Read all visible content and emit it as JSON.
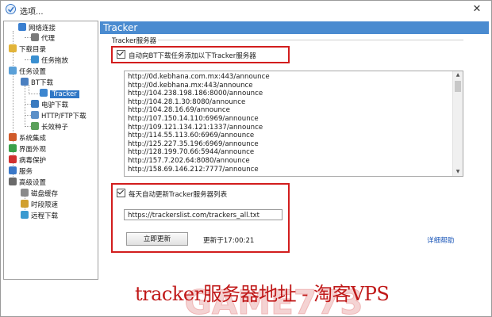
{
  "window": {
    "title": "选项..."
  },
  "tree": [
    {
      "label": "网络连接",
      "icon": "network-icon",
      "color": "#3a7fd0"
    },
    {
      "label": "代理",
      "icon": "proxy-icon",
      "color": "#7a7a7a"
    },
    {
      "label": "下载目录",
      "icon": "folder-icon",
      "color": "#e2b43a"
    },
    {
      "label": "任务拖放",
      "icon": "drag-icon",
      "color": "#3a8fd0"
    },
    {
      "label": "任务设置",
      "icon": "task-settings-icon",
      "color": "#5aa0d8"
    },
    {
      "label": "BT下载",
      "icon": "bt-icon",
      "color": "#4a7fc0"
    },
    {
      "label": "Tracker",
      "icon": "tracker-icon",
      "color": "#3d86cf"
    },
    {
      "label": "电驴下载",
      "icon": "emule-icon",
      "color": "#3a7bc0"
    },
    {
      "label": "HTTP/FTP下载",
      "icon": "http-ftp-icon",
      "color": "#5b90c8"
    },
    {
      "label": "长效种子",
      "icon": "seed-icon",
      "color": "#5aa05a"
    },
    {
      "label": "系统集成",
      "icon": "system-integration-icon",
      "color": "#d05a2a"
    },
    {
      "label": "界面外观",
      "icon": "appearance-icon",
      "color": "#3aa04a"
    },
    {
      "label": "病毒保护",
      "icon": "virus-protection-icon",
      "color": "#d03030"
    },
    {
      "label": "服务",
      "icon": "service-icon",
      "color": "#3a78c8"
    },
    {
      "label": "高级设置",
      "icon": "advanced-settings-icon",
      "color": "#6a6a6a"
    },
    {
      "label": "磁盘缓存",
      "icon": "disk-cache-icon",
      "color": "#8a8a8a"
    },
    {
      "label": "时段限速",
      "icon": "speed-limit-icon",
      "color": "#d0a030"
    },
    {
      "label": "远程下载",
      "icon": "remote-download-icon",
      "color": "#3a9ad0"
    }
  ],
  "panel": {
    "title": "Tracker",
    "group_label": "Tracker服务器",
    "auto_add_label": "自动向BT下载任务添加以下Tracker服务器",
    "auto_add_checked": true,
    "trackers": [
      "http://0d.kebhana.com.mx:443/announce",
      "http://0d.kebhana.mx:443/announce",
      "http://104.238.198.186:8000/announce",
      "http://104.28.1.30:8080/announce",
      "http://104.28.16.69/announce",
      "http://107.150.14.110:6969/announce",
      "http://109.121.134.121:1337/announce",
      "http://114.55.113.60:6969/announce",
      "http://125.227.35.196:6969/announce",
      "http://128.199.70.66:5944/announce",
      "http://157.7.202.64:8080/announce",
      "http://158.69.146.212:7777/announce"
    ],
    "daily_update_label": "每天自动更新Tracker服务器列表",
    "daily_update_checked": true,
    "update_url": "https://trackerslist.com/trackers_all.txt",
    "update_now_label": "立即更新",
    "updated_at": "更新于17:00:21",
    "help_link": "详细帮助"
  },
  "watermark": {
    "logo_text": "GAME773",
    "caption": "tracker服务器地址 - 淘客VPS"
  }
}
